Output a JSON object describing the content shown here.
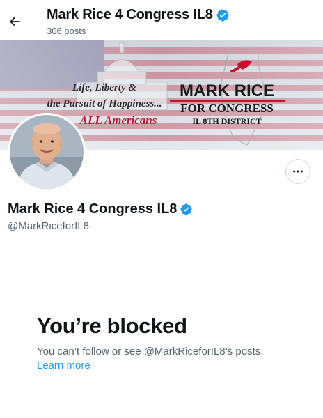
{
  "header": {
    "back_icon": "arrow-left-icon",
    "name": "Mark Rice 4 Congress IL8",
    "posts": "306 posts",
    "verified_icon": "verified-badge-icon"
  },
  "banner": {
    "slogan_line1": "Life, Liberty &",
    "slogan_line2": "the Pursuit of Happiness...",
    "slogan_line3": "ALL Americans",
    "campaign_name": "MARK RICE",
    "campaign_sub": "FOR CONGRESS",
    "district": "IL 8TH DISTRICT"
  },
  "profile": {
    "display_name": "Mark Rice 4 Congress IL8",
    "handle": "@MarkRiceforIL8",
    "more_icon": "more-options-icon"
  },
  "blocked": {
    "title": "You’re blocked",
    "message": "You can’t follow or see @MarkRiceforIL8’s posts.",
    "link": "Learn more"
  },
  "colors": {
    "accent": "#1d9bf0",
    "text": "#0f1419",
    "muted": "#536471",
    "banner_red": "#c8102e"
  }
}
